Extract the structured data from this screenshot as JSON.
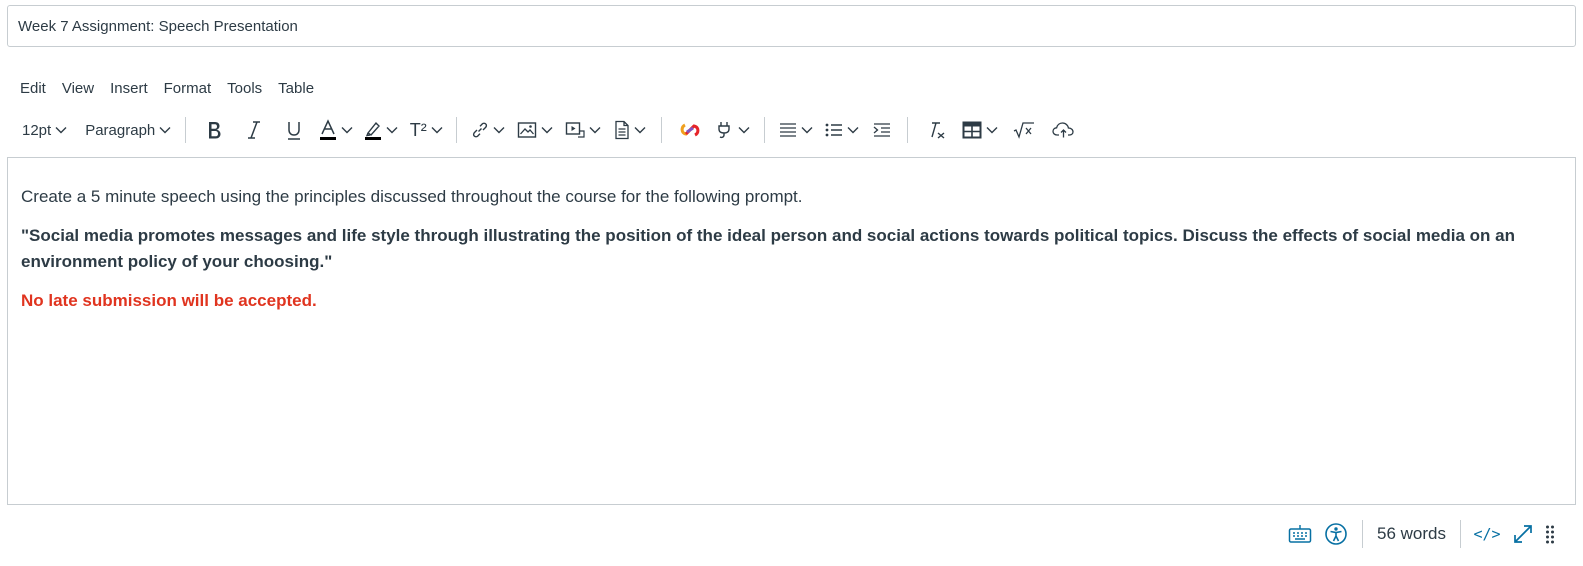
{
  "title": {
    "value": "Week 7 Assignment: Speech Presentation"
  },
  "menubar": {
    "items": [
      "Edit",
      "View",
      "Insert",
      "Format",
      "Tools",
      "Table"
    ]
  },
  "toolbar": {
    "font_size": "12pt",
    "block_format": "Paragraph",
    "superscript_label": "T²",
    "icons": [
      "bold-icon",
      "italic-icon",
      "underline-icon",
      "text-color-icon",
      "highlight-color-icon",
      "superscript-icon",
      "link-icon",
      "image-icon",
      "media-icon",
      "document-icon",
      "apps-icon",
      "plugin-icon",
      "align-icon",
      "list-icon",
      "indent-icon",
      "clear-formatting-icon",
      "table-icon",
      "equation-icon",
      "cloud-upload-icon"
    ]
  },
  "editor": {
    "paragraphs": [
      "Create a 5 minute speech using the principles discussed throughout the course for the following prompt.",
      "\"Social media promotes messages and life style through illustrating the position of the ideal person and social actions towards political topics. Discuss the effects of social media on an environment policy of your choosing.\"",
      "No late submission will be accepted."
    ]
  },
  "statusbar": {
    "word_count": "56 words",
    "html_toggle": "</>"
  },
  "colors": {
    "text": "#2d3b45",
    "accent_blue": "#0770a3",
    "warning_red": "#e0341f",
    "border": "#c7cdd1"
  }
}
